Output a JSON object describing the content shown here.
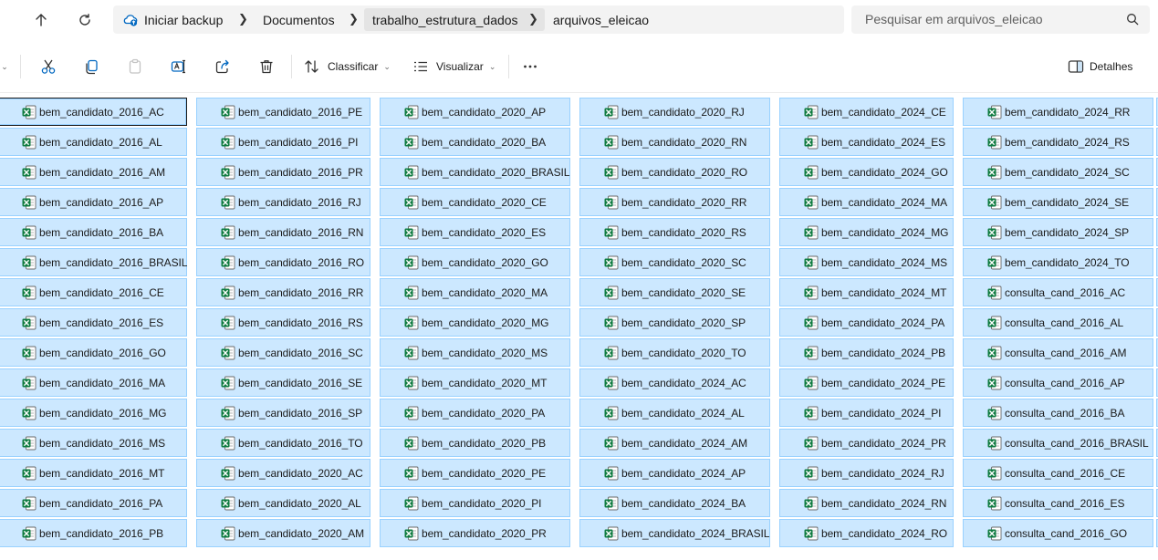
{
  "colors": {
    "selection_bg": "#cce8ff",
    "selection_border": "#99d1ff",
    "excel_green": "#107c41",
    "accent_blue": "#0067c0"
  },
  "breadcrumb": {
    "root_label": "Iniciar backup",
    "items": [
      "Documentos",
      "trabalho_estrutura_dados",
      "arquivos_eleicao"
    ]
  },
  "search": {
    "placeholder": "Pesquisar em arquivos_eleicao"
  },
  "commandbar": {
    "sort_label": "Classificar",
    "view_label": "Visualizar",
    "details_label": "Detalhes"
  },
  "files": {
    "icon": "excel-file-icon",
    "columns": [
      [
        "bem_candidato_2016_AC",
        "bem_candidato_2016_AL",
        "bem_candidato_2016_AM",
        "bem_candidato_2016_AP",
        "bem_candidato_2016_BA",
        "bem_candidato_2016_BRASIL",
        "bem_candidato_2016_CE",
        "bem_candidato_2016_ES",
        "bem_candidato_2016_GO",
        "bem_candidato_2016_MA",
        "bem_candidato_2016_MG",
        "bem_candidato_2016_MS",
        "bem_candidato_2016_MT",
        "bem_candidato_2016_PA",
        "bem_candidato_2016_PB"
      ],
      [
        "bem_candidato_2016_PE",
        "bem_candidato_2016_PI",
        "bem_candidato_2016_PR",
        "bem_candidato_2016_RJ",
        "bem_candidato_2016_RN",
        "bem_candidato_2016_RO",
        "bem_candidato_2016_RR",
        "bem_candidato_2016_RS",
        "bem_candidato_2016_SC",
        "bem_candidato_2016_SE",
        "bem_candidato_2016_SP",
        "bem_candidato_2016_TO",
        "bem_candidato_2020_AC",
        "bem_candidato_2020_AL",
        "bem_candidato_2020_AM"
      ],
      [
        "bem_candidato_2020_AP",
        "bem_candidato_2020_BA",
        "bem_candidato_2020_BRASIL",
        "bem_candidato_2020_CE",
        "bem_candidato_2020_ES",
        "bem_candidato_2020_GO",
        "bem_candidato_2020_MA",
        "bem_candidato_2020_MG",
        "bem_candidato_2020_MS",
        "bem_candidato_2020_MT",
        "bem_candidato_2020_PA",
        "bem_candidato_2020_PB",
        "bem_candidato_2020_PE",
        "bem_candidato_2020_PI",
        "bem_candidato_2020_PR"
      ],
      [
        "bem_candidato_2020_RJ",
        "bem_candidato_2020_RN",
        "bem_candidato_2020_RO",
        "bem_candidato_2020_RR",
        "bem_candidato_2020_RS",
        "bem_candidato_2020_SC",
        "bem_candidato_2020_SE",
        "bem_candidato_2020_SP",
        "bem_candidato_2020_TO",
        "bem_candidato_2024_AC",
        "bem_candidato_2024_AL",
        "bem_candidato_2024_AM",
        "bem_candidato_2024_AP",
        "bem_candidato_2024_BA",
        "bem_candidato_2024_BRASIL"
      ],
      [
        "bem_candidato_2024_CE",
        "bem_candidato_2024_ES",
        "bem_candidato_2024_GO",
        "bem_candidato_2024_MA",
        "bem_candidato_2024_MG",
        "bem_candidato_2024_MS",
        "bem_candidato_2024_MT",
        "bem_candidato_2024_PA",
        "bem_candidato_2024_PB",
        "bem_candidato_2024_PE",
        "bem_candidato_2024_PI",
        "bem_candidato_2024_PR",
        "bem_candidato_2024_RJ",
        "bem_candidato_2024_RN",
        "bem_candidato_2024_RO"
      ],
      [
        "bem_candidato_2024_RR",
        "bem_candidato_2024_RS",
        "bem_candidato_2024_SC",
        "bem_candidato_2024_SE",
        "bem_candidato_2024_SP",
        "bem_candidato_2024_TO",
        "consulta_cand_2016_AC",
        "consulta_cand_2016_AL",
        "consulta_cand_2016_AM",
        "consulta_cand_2016_AP",
        "consulta_cand_2016_BA",
        "consulta_cand_2016_BRASIL",
        "consulta_cand_2016_CE",
        "consulta_cand_2016_ES",
        "consulta_cand_2016_GO"
      ]
    ]
  }
}
